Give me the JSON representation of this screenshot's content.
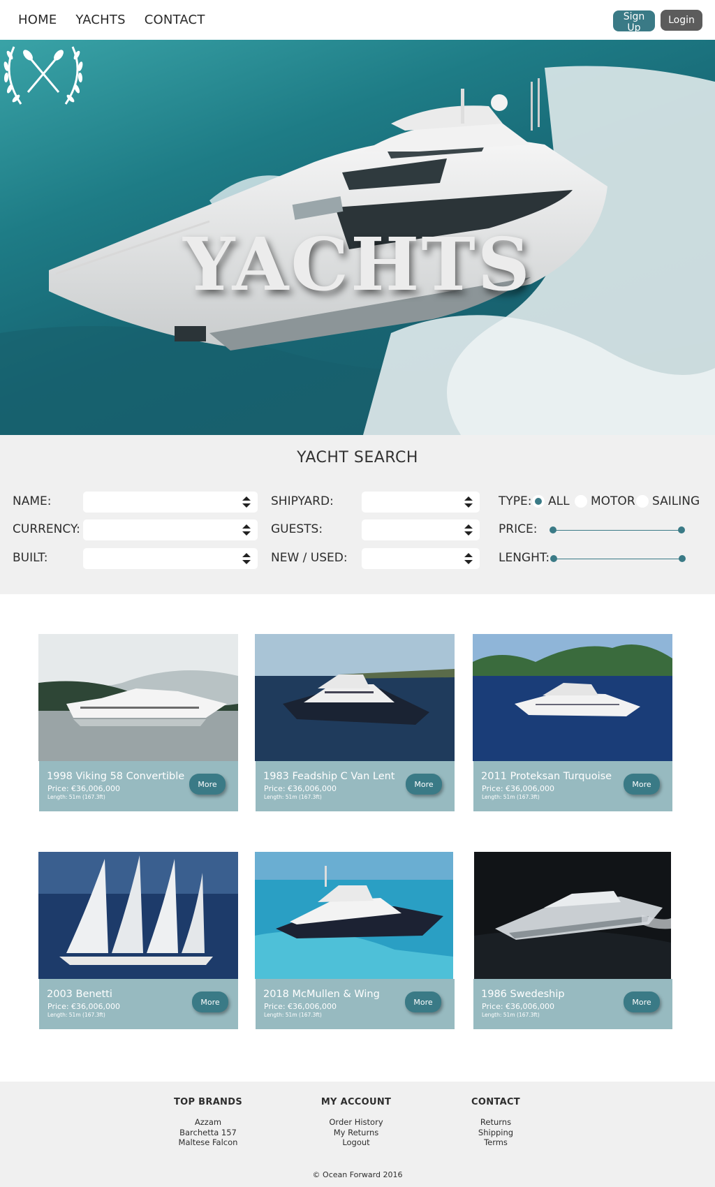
{
  "nav": {
    "links": [
      "HOME",
      "YACHTS",
      "CONTACT"
    ],
    "signup_label": "Sign Up",
    "login_label": "Login"
  },
  "hero": {
    "title": "YACHTS"
  },
  "search": {
    "title": "YACHT SEARCH",
    "name_label": "NAME:",
    "currency_label": "CURRENCY:",
    "built_label": "BUILT:",
    "shipyard_label": "SHIPYARD:",
    "guests_label": "GUESTS:",
    "new_used_label": "NEW / USED:",
    "type_label": "TYPE:",
    "type_options": [
      "ALL",
      "MOTOR",
      "SAILING"
    ],
    "type_selected": "ALL",
    "price_label": "PRICE:",
    "length_label": "LENGHT:"
  },
  "yachts": [
    {
      "name": "1998 Viking 58 Convertible",
      "price": "Price: €36,006,000",
      "length": "Length: 51m (167.3ft)",
      "more_label": "More"
    },
    {
      "name": "1983 Feadship C Van Lent",
      "price": "Price: €36,006,000",
      "length": "Length: 51m (167.3ft)",
      "more_label": "More"
    },
    {
      "name": "2011 Proteksan Turquoise",
      "price": "Price: €36,006,000",
      "length": "Length: 51m (167.3ft)",
      "more_label": "More"
    },
    {
      "name": "2003 Benetti",
      "price": "Price: €36,006,000",
      "length": "Length: 51m (167.3ft)",
      "more_label": "More"
    },
    {
      "name": "2018 McMullen & Wing",
      "price": "Price: €36,006,000",
      "length": "Length: 51m (167.3ft)",
      "more_label": "More"
    },
    {
      "name": "1986 Swedeship",
      "price": "Price: €36,006,000",
      "length": "Length: 51m (167.3ft)",
      "more_label": "More"
    }
  ],
  "footer": {
    "columns": [
      {
        "heading": "TOP BRANDS",
        "items": [
          "Azzam",
          "Barchetta 157",
          "Maltese Falcon"
        ]
      },
      {
        "heading": "MY ACCOUNT",
        "items": [
          "Order History",
          "My Returns",
          "Logout"
        ]
      },
      {
        "heading": "CONTACT",
        "items": [
          "Returns",
          "Shipping",
          "Terms"
        ]
      }
    ],
    "copyright": "© Ocean Forward 2016"
  },
  "colors": {
    "accent": "#3a7a86",
    "card_info": "#97bac0",
    "panel_bg": "#f0f0f0",
    "login_bg": "#5c5c5c"
  }
}
